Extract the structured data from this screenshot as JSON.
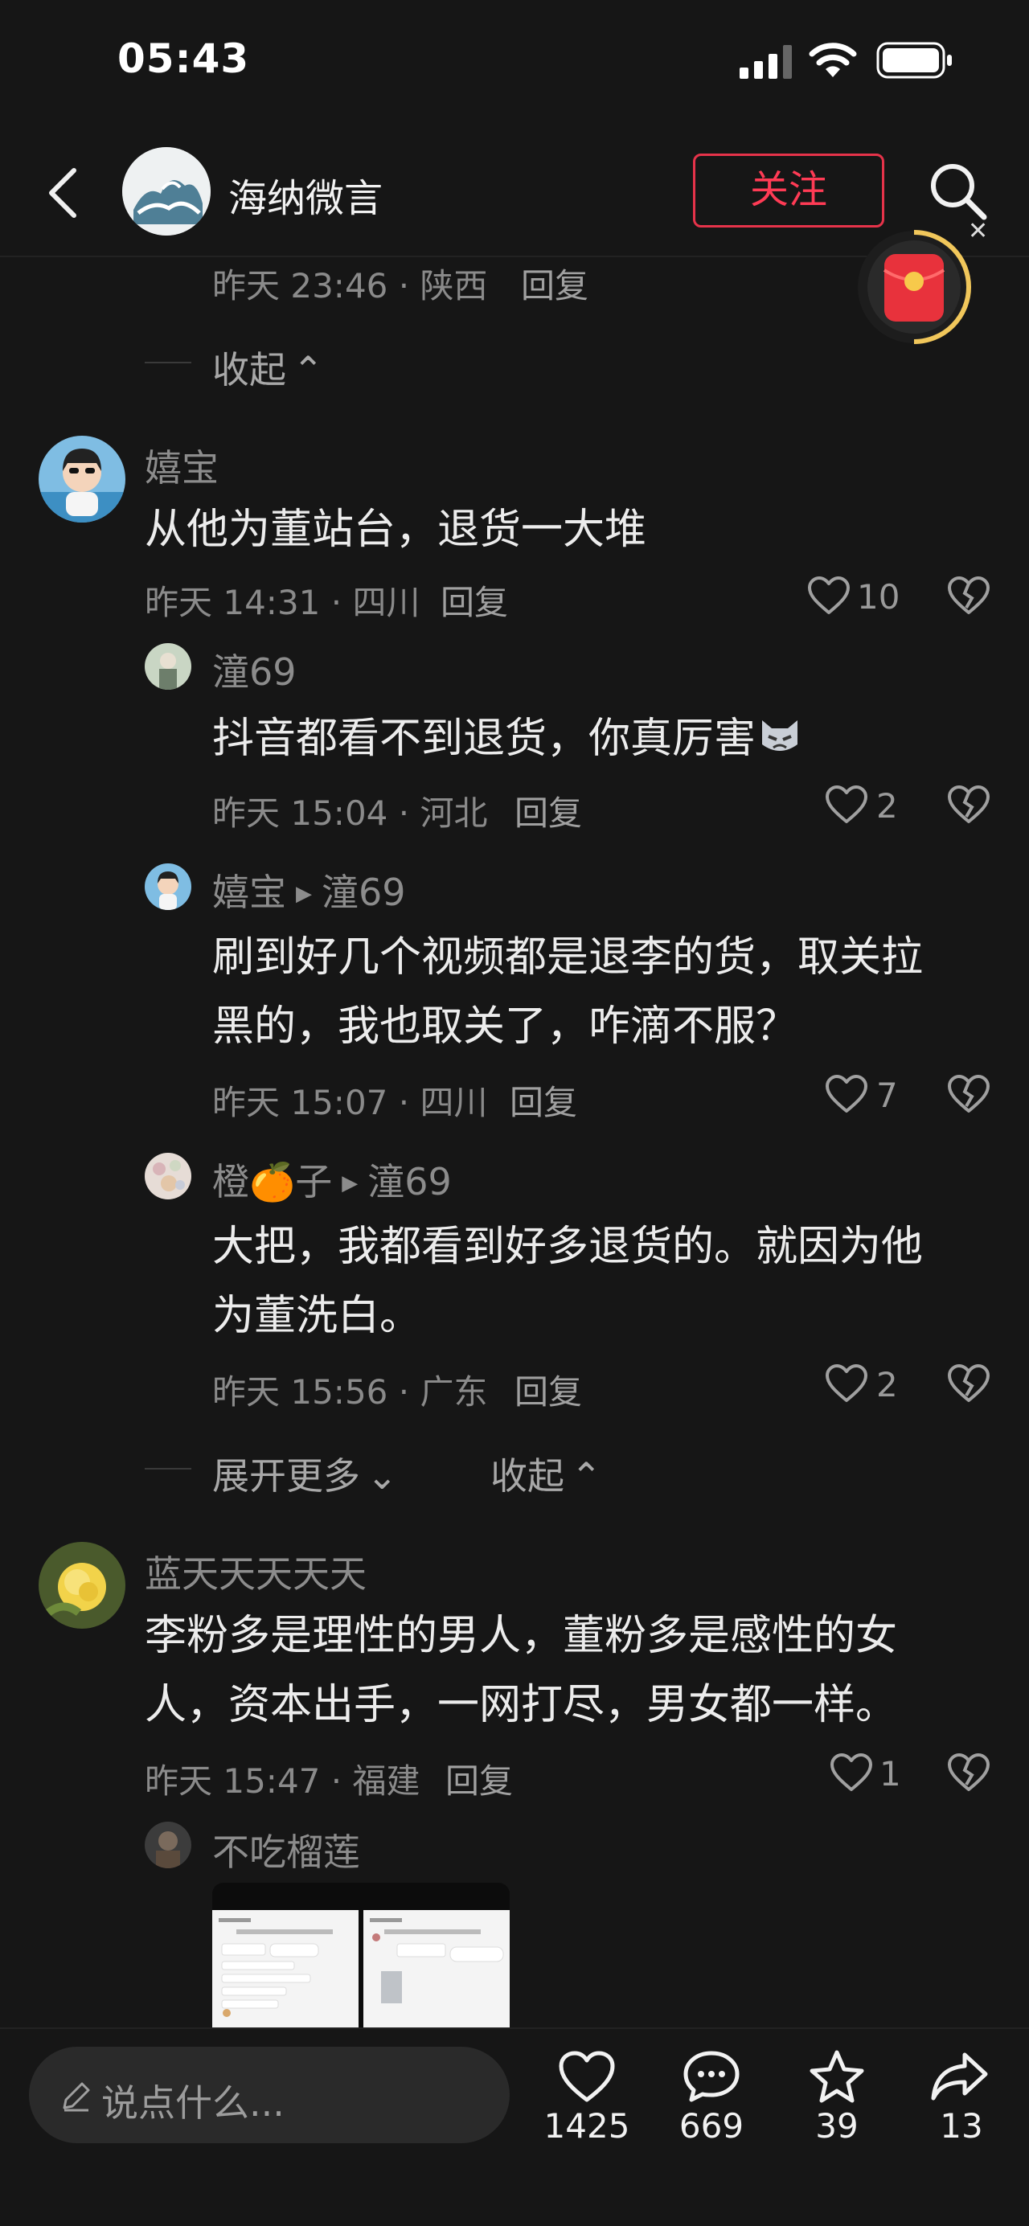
{
  "status_bar": {
    "time": "05:43"
  },
  "header": {
    "account_name": "海纳微言",
    "follow_label": "关注"
  },
  "comments": {
    "prev_reply_meta": "昨天 23:46 · 陕西",
    "prev_reply_label": "回复",
    "collapse_top": "收起",
    "c1": {
      "user": "嬉宝",
      "text": "从他为董站台，退货一大堆",
      "meta": "昨天 14:31 · 四川",
      "reply": "回复",
      "likes": "10",
      "replies": [
        {
          "user": "潼69",
          "text": "抖音都看不到退货，你真厉害",
          "meta": "昨天 15:04 · 河北",
          "reply": "回复",
          "likes": "2"
        },
        {
          "user": "嬉宝",
          "to": "潼69",
          "text1": "刷到好几个视频都是退李的货，取关拉",
          "text2": "黑的，我也取关了，咋滴不服？",
          "meta": "昨天 15:07 · 四川",
          "reply": "回复",
          "likes": "7"
        },
        {
          "user": "橙🍊子",
          "to": "潼69",
          "text1": "大把，我都看到好多退货的。就因为他",
          "text2": "为董洗白。",
          "meta": "昨天 15:56 · 广东",
          "reply": "回复",
          "likes": "2"
        }
      ],
      "expand_more": "展开更多",
      "collapse": "收起"
    },
    "c2": {
      "user": "蓝天天天天天",
      "text1": "李粉多是理性的男人，董粉多是感性的女",
      "text2": "人，资本出手，一网打尽，男女都一样。",
      "meta": "昨天 15:47 · 福建",
      "reply": "回复",
      "likes": "1",
      "reply_user": "不吃榴莲"
    }
  },
  "bottom_bar": {
    "input_placeholder": "说点什么...",
    "likes": "1425",
    "comments": "669",
    "favorites": "39",
    "shares": "13"
  },
  "colors": {
    "accent": "#ff3b55",
    "background": "#161616",
    "text": "#ececec",
    "muted": "#8a8a8a"
  }
}
